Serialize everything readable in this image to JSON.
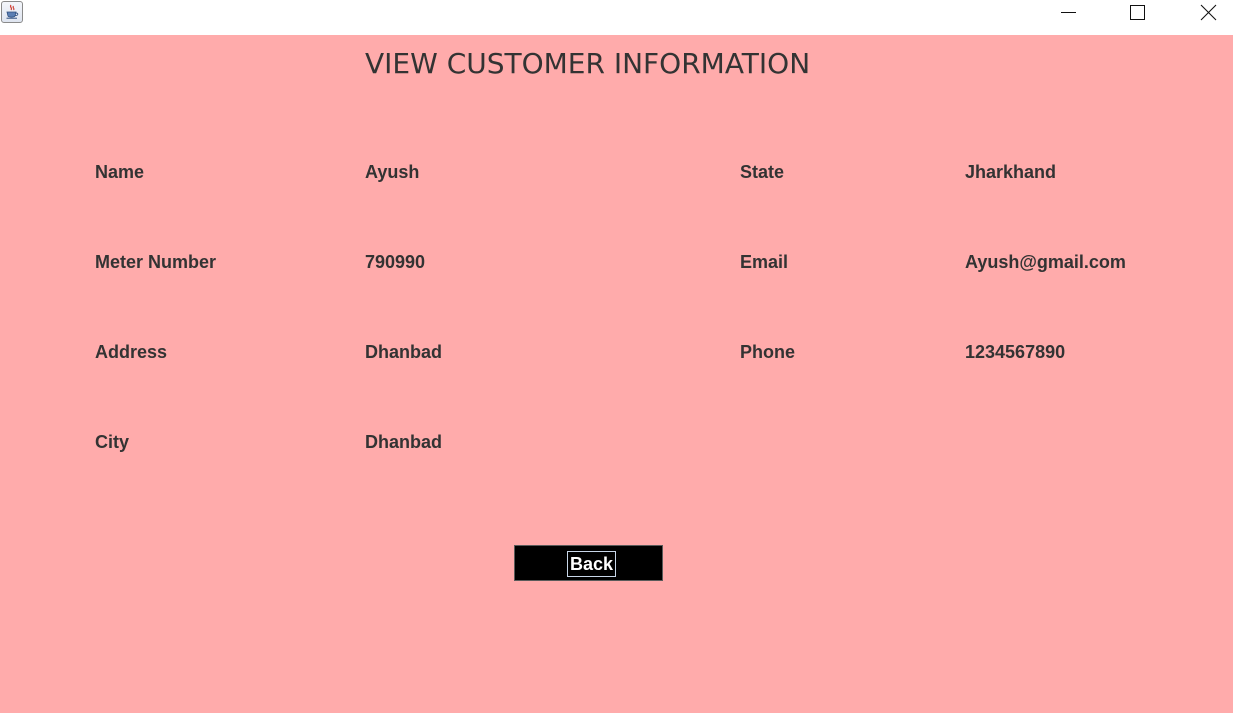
{
  "titlebar": {
    "app_icon": "java-cup-icon",
    "controls": [
      "minimize-icon",
      "maximize-icon",
      "close-icon"
    ]
  },
  "page": {
    "heading": "VIEW CUSTOMER INFORMATION",
    "background_color": "#ffabab",
    "text_color": "#333333"
  },
  "fields": {
    "name": {
      "label": "Name",
      "value": "Ayush"
    },
    "meter_number": {
      "label": "Meter Number",
      "value": "790990"
    },
    "address": {
      "label": "Address",
      "value": "Dhanbad"
    },
    "city": {
      "label": "City",
      "value": "Dhanbad"
    },
    "state": {
      "label": "State",
      "value": "Jharkhand"
    },
    "email": {
      "label": "Email",
      "value": "Ayush@gmail.com"
    },
    "phone": {
      "label": "Phone",
      "value": "1234567890"
    }
  },
  "actions": {
    "back_label": "Back",
    "back_bg_color": "#000000",
    "back_text_color": "#ffffff"
  }
}
